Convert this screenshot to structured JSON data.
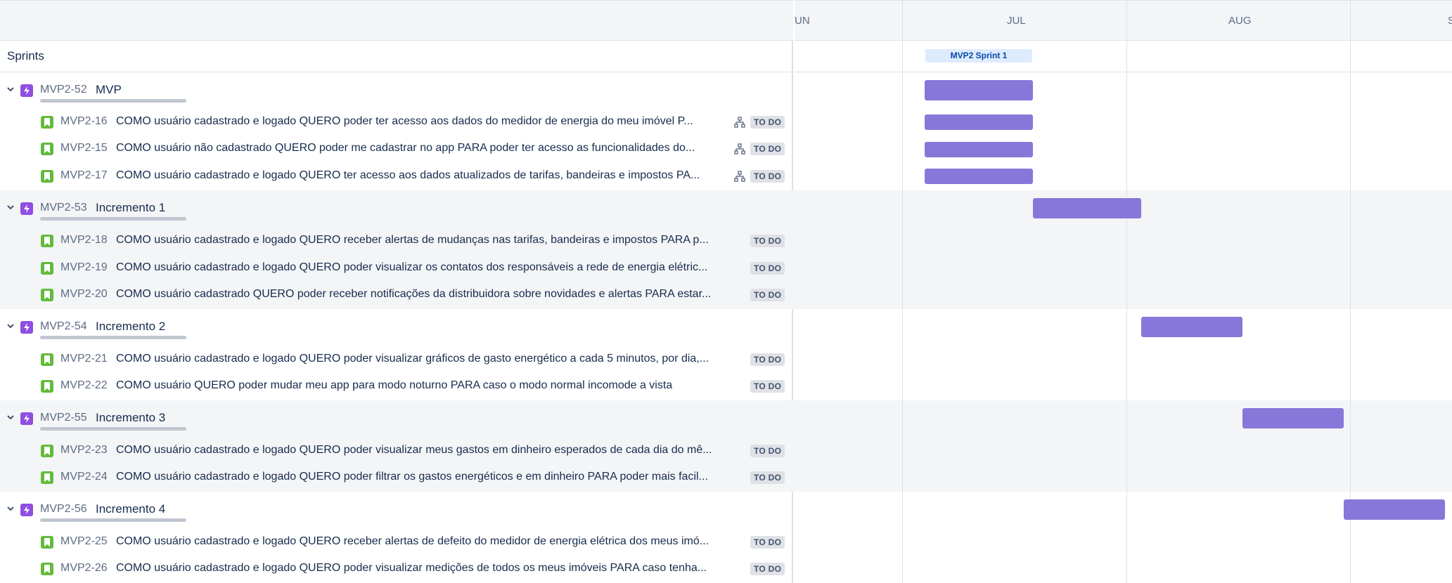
{
  "timeline": {
    "months": [
      "UN",
      "JUL",
      "AUG",
      "S"
    ],
    "sprint_chip": "MVP2 Sprint 1"
  },
  "sidebar": {
    "sprints_label": "Sprints"
  },
  "groups": [
    {
      "key": "MVP2-52",
      "title": "MVP",
      "stories": [
        {
          "key": "MVP2-16",
          "summary": "COMO usuário cadastrado e logado QUERO poder ter acesso aos dados do medidor de energia do meu imóvel P...",
          "status": "TO DO",
          "has_children_icon": true
        },
        {
          "key": "MVP2-15",
          "summary": "COMO usuário não cadastrado QUERO poder me cadastrar no app PARA poder ter acesso as funcionalidades do...",
          "status": "TO DO",
          "has_children_icon": true
        },
        {
          "key": "MVP2-17",
          "summary": "COMO usuário cadastrado e logado QUERO ter acesso aos dados atualizados de tarifas, bandeiras e impostos PA...",
          "status": "TO DO",
          "has_children_icon": true
        }
      ]
    },
    {
      "key": "MVP2-53",
      "title": "Incremento 1",
      "stories": [
        {
          "key": "MVP2-18",
          "summary": "COMO usuário cadastrado e logado QUERO receber alertas de mudanças nas tarifas, bandeiras e impostos PARA p...",
          "status": "TO DO"
        },
        {
          "key": "MVP2-19",
          "summary": "COMO usuário cadastrado e logado QUERO poder visualizar os contatos dos responsáveis a rede de energia elétric...",
          "status": "TO DO"
        },
        {
          "key": "MVP2-20",
          "summary": "COMO usuário cadastrado QUERO poder receber notificações da distribuidora sobre novidades e alertas PARA estar...",
          "status": "TO DO"
        }
      ]
    },
    {
      "key": "MVP2-54",
      "title": "Incremento 2",
      "stories": [
        {
          "key": "MVP2-21",
          "summary": "COMO usuário cadastrado e logado QUERO poder visualizar gráficos de gasto energético a cada 5 minutos, por dia,...",
          "status": "TO DO"
        },
        {
          "key": "MVP2-22",
          "summary": "COMO usuário QUERO poder mudar meu app para modo noturno PARA caso o modo normal incomode a vista",
          "status": "TO DO"
        }
      ]
    },
    {
      "key": "MVP2-55",
      "title": "Incremento 3",
      "stories": [
        {
          "key": "MVP2-23",
          "summary": "COMO usuário cadastrado e logado QUERO poder visualizar meus gastos em dinheiro esperados de cada dia do mê...",
          "status": "TO DO"
        },
        {
          "key": "MVP2-24",
          "summary": "COMO usuário cadastrado e logado QUERO poder filtrar os gastos energéticos e em dinheiro PARA poder mais facil...",
          "status": "TO DO"
        }
      ]
    },
    {
      "key": "MVP2-56",
      "title": "Incremento 4",
      "stories": [
        {
          "key": "MVP2-25",
          "summary": "COMO usuário cadastrado e logado QUERO receber alertas de defeito do medidor de energia elétrica dos meus imó...",
          "status": "TO DO"
        },
        {
          "key": "MVP2-26",
          "summary": "COMO usuário cadastrado e logado QUERO poder visualizar medições de todos os meus imóveis PARA caso tenha...",
          "status": "TO DO"
        }
      ]
    }
  ],
  "colors": {
    "epic": "#904ee2",
    "story": "#63ba3c",
    "bar": "#8777d9",
    "sprint_chip_bg": "#deebff"
  }
}
